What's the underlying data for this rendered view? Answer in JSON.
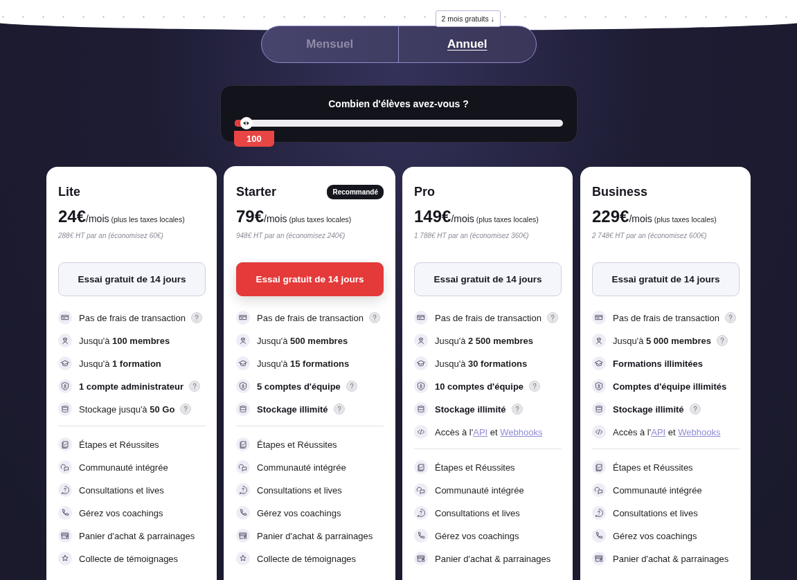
{
  "billing_toggle": {
    "badge": "2 mois gratuits ↓",
    "options": [
      {
        "label": "Mensuel",
        "selected": false
      },
      {
        "label": "Annuel",
        "selected": true
      }
    ]
  },
  "students": {
    "question": "Combien d'élèves avez-vous ?",
    "level": 0.02,
    "value": "100"
  },
  "plans": [
    {
      "name": "Lite",
      "featured": false,
      "price": "24€",
      "period": "/mois",
      "tax": "(plus les taxes locales)",
      "annual": "288€ HT par an (économisez 60€)",
      "cta": "Essai gratuit de 14 jours",
      "feature_groups": [
        [
          {
            "kind": "card",
            "parts": [
              {
                "text": "Pas de frais de transaction",
                "link": false
              }
            ],
            "strong": false,
            "help": true
          },
          {
            "kind": "member",
            "parts": [
              {
                "text": "Jusqu'à **100 membres**",
                "link": false
              }
            ],
            "strong": false,
            "help": false
          },
          {
            "kind": "course",
            "parts": [
              {
                "text": "Jusqu'à **1 formation**",
                "link": false
              }
            ],
            "strong": false,
            "help": false
          },
          {
            "kind": "shield",
            "parts": [
              {
                "text": "1 compte administrateur",
                "link": false
              }
            ],
            "strong": true,
            "help": true
          },
          {
            "kind": "storage",
            "parts": [
              {
                "text": "Stockage jusqu'à **50 Go**",
                "link": false
              }
            ],
            "strong": false,
            "help": true
          }
        ],
        [
          {
            "kind": "steps",
            "parts": [
              {
                "text": "Étapes et Réussites",
                "link": false
              }
            ],
            "strong": false,
            "help": false
          },
          {
            "kind": "community",
            "parts": [
              {
                "text": "Communauté intégrée",
                "link": false
              }
            ],
            "strong": false,
            "help": false
          },
          {
            "kind": "consult",
            "parts": [
              {
                "text": "Consultations et lives",
                "link": false
              }
            ],
            "strong": false,
            "help": false
          },
          {
            "kind": "phone",
            "parts": [
              {
                "text": "Gérez vos coachings",
                "link": false
              }
            ],
            "strong": false,
            "help": false
          },
          {
            "kind": "cart",
            "parts": [
              {
                "text": "Panier d'achat & parrainages",
                "link": false
              }
            ],
            "strong": false,
            "help": false
          },
          {
            "kind": "star",
            "parts": [
              {
                "text": "Collecte de témoignages",
                "link": false
              }
            ],
            "strong": false,
            "help": false
          }
        ]
      ]
    },
    {
      "name": "Starter",
      "badge": "Recommandé",
      "featured": true,
      "price": "79€",
      "period": "/mois",
      "tax": "(plus taxes locales)",
      "annual": "948€ HT par an (économisez 240€)",
      "cta": "Essai gratuit de 14 jours",
      "feature_groups": [
        [
          {
            "kind": "card",
            "parts": [
              {
                "text": "Pas de frais de transaction",
                "link": false
              }
            ],
            "strong": false,
            "help": true
          },
          {
            "kind": "member",
            "parts": [
              {
                "text": "Jusqu'à **500 membres**",
                "link": false
              }
            ],
            "strong": false,
            "help": false
          },
          {
            "kind": "course",
            "parts": [
              {
                "text": "Jusqu'à **15 formations**",
                "link": false
              }
            ],
            "strong": false,
            "help": false
          },
          {
            "kind": "shield",
            "parts": [
              {
                "text": "5 comptes d'équipe",
                "link": false
              }
            ],
            "strong": true,
            "help": true
          },
          {
            "kind": "storage",
            "parts": [
              {
                "text": "Stockage illimité",
                "link": false
              }
            ],
            "strong": true,
            "help": true
          }
        ],
        [
          {
            "kind": "steps",
            "parts": [
              {
                "text": "Étapes et Réussites",
                "link": false
              }
            ],
            "strong": false,
            "help": false
          },
          {
            "kind": "community",
            "parts": [
              {
                "text": "Communauté intégrée",
                "link": false
              }
            ],
            "strong": false,
            "help": false
          },
          {
            "kind": "consult",
            "parts": [
              {
                "text": "Consultations et lives",
                "link": false
              }
            ],
            "strong": false,
            "help": false
          },
          {
            "kind": "phone",
            "parts": [
              {
                "text": "Gérez vos coachings",
                "link": false
              }
            ],
            "strong": false,
            "help": false
          },
          {
            "kind": "cart",
            "parts": [
              {
                "text": "Panier d'achat & parrainages",
                "link": false
              }
            ],
            "strong": false,
            "help": false
          },
          {
            "kind": "star",
            "parts": [
              {
                "text": "Collecte de témoignages",
                "link": false
              }
            ],
            "strong": false,
            "help": false
          }
        ]
      ]
    },
    {
      "name": "Pro",
      "featured": false,
      "price": "149€",
      "period": "/mois",
      "tax": "(plus taxes locales)",
      "annual": "1 788€ HT par an (économisez 360€)",
      "cta": "Essai gratuit de 14 jours",
      "feature_groups": [
        [
          {
            "kind": "card",
            "parts": [
              {
                "text": "Pas de frais de transaction",
                "link": false
              }
            ],
            "strong": false,
            "help": true
          },
          {
            "kind": "member",
            "parts": [
              {
                "text": "Jusqu'à **2 500 membres**",
                "link": false
              }
            ],
            "strong": false,
            "help": false
          },
          {
            "kind": "course",
            "parts": [
              {
                "text": "Jusqu'à **30 formations**",
                "link": false
              }
            ],
            "strong": false,
            "help": false
          },
          {
            "kind": "shield",
            "parts": [
              {
                "text": "10 comptes d'équipe",
                "link": false
              }
            ],
            "strong": true,
            "help": true
          },
          {
            "kind": "storage",
            "parts": [
              {
                "text": "Stockage illimité",
                "link": false
              }
            ],
            "strong": true,
            "help": true
          },
          {
            "kind": "code",
            "parts": [
              {
                "text": "Accès à l'",
                "link": false
              },
              {
                "text": "API",
                "link": true
              },
              {
                "text": " et ",
                "link": false
              },
              {
                "text": "Webhooks",
                "link": true
              }
            ],
            "strong": false,
            "help": false
          }
        ],
        [
          {
            "kind": "steps",
            "parts": [
              {
                "text": "Étapes et Réussites",
                "link": false
              }
            ],
            "strong": false,
            "help": false
          },
          {
            "kind": "community",
            "parts": [
              {
                "text": "Communauté intégrée",
                "link": false
              }
            ],
            "strong": false,
            "help": false
          },
          {
            "kind": "consult",
            "parts": [
              {
                "text": "Consultations et lives",
                "link": false
              }
            ],
            "strong": false,
            "help": false
          },
          {
            "kind": "phone",
            "parts": [
              {
                "text": "Gérez vos coachings",
                "link": false
              }
            ],
            "strong": false,
            "help": false
          },
          {
            "kind": "cart",
            "parts": [
              {
                "text": "Panier d'achat & parrainages",
                "link": false
              }
            ],
            "strong": false,
            "help": false
          }
        ]
      ]
    },
    {
      "name": "Business",
      "featured": false,
      "price": "229€",
      "period": "/mois",
      "tax": "(plus taxes locales)",
      "annual": "2 748€ HT par an (économisez 600€)",
      "cta": "Essai gratuit de 14 jours",
      "feature_groups": [
        [
          {
            "kind": "card",
            "parts": [
              {
                "text": "Pas de frais de transaction",
                "link": false
              }
            ],
            "strong": false,
            "help": true
          },
          {
            "kind": "member",
            "parts": [
              {
                "text": "Jusqu'à **5 000 membres**",
                "link": false
              }
            ],
            "strong": false,
            "help": true
          },
          {
            "kind": "course",
            "parts": [
              {
                "text": "Formations illimitées",
                "link": false
              }
            ],
            "strong": true,
            "help": false
          },
          {
            "kind": "shield",
            "parts": [
              {
                "text": "Comptes d'équipe illimités",
                "link": false
              }
            ],
            "strong": true,
            "help": false
          },
          {
            "kind": "storage",
            "parts": [
              {
                "text": "Stockage illimité",
                "link": false
              }
            ],
            "strong": true,
            "help": true
          },
          {
            "kind": "code",
            "parts": [
              {
                "text": "Accès à l'",
                "link": false
              },
              {
                "text": "API",
                "link": true
              },
              {
                "text": " et ",
                "link": false
              },
              {
                "text": "Webhooks",
                "link": true
              }
            ],
            "strong": false,
            "help": false
          }
        ],
        [
          {
            "kind": "steps",
            "parts": [
              {
                "text": "Étapes et Réussites",
                "link": false
              }
            ],
            "strong": false,
            "help": false
          },
          {
            "kind": "community",
            "parts": [
              {
                "text": "Communauté intégrée",
                "link": false
              }
            ],
            "strong": false,
            "help": false
          },
          {
            "kind": "consult",
            "parts": [
              {
                "text": "Consultations et lives",
                "link": false
              }
            ],
            "strong": false,
            "help": false
          },
          {
            "kind": "phone",
            "parts": [
              {
                "text": "Gérez vos coachings",
                "link": false
              }
            ],
            "strong": false,
            "help": false
          },
          {
            "kind": "cart",
            "parts": [
              {
                "text": "Panier d'achat & parrainages",
                "link": false
              }
            ],
            "strong": false,
            "help": false
          }
        ]
      ]
    }
  ]
}
